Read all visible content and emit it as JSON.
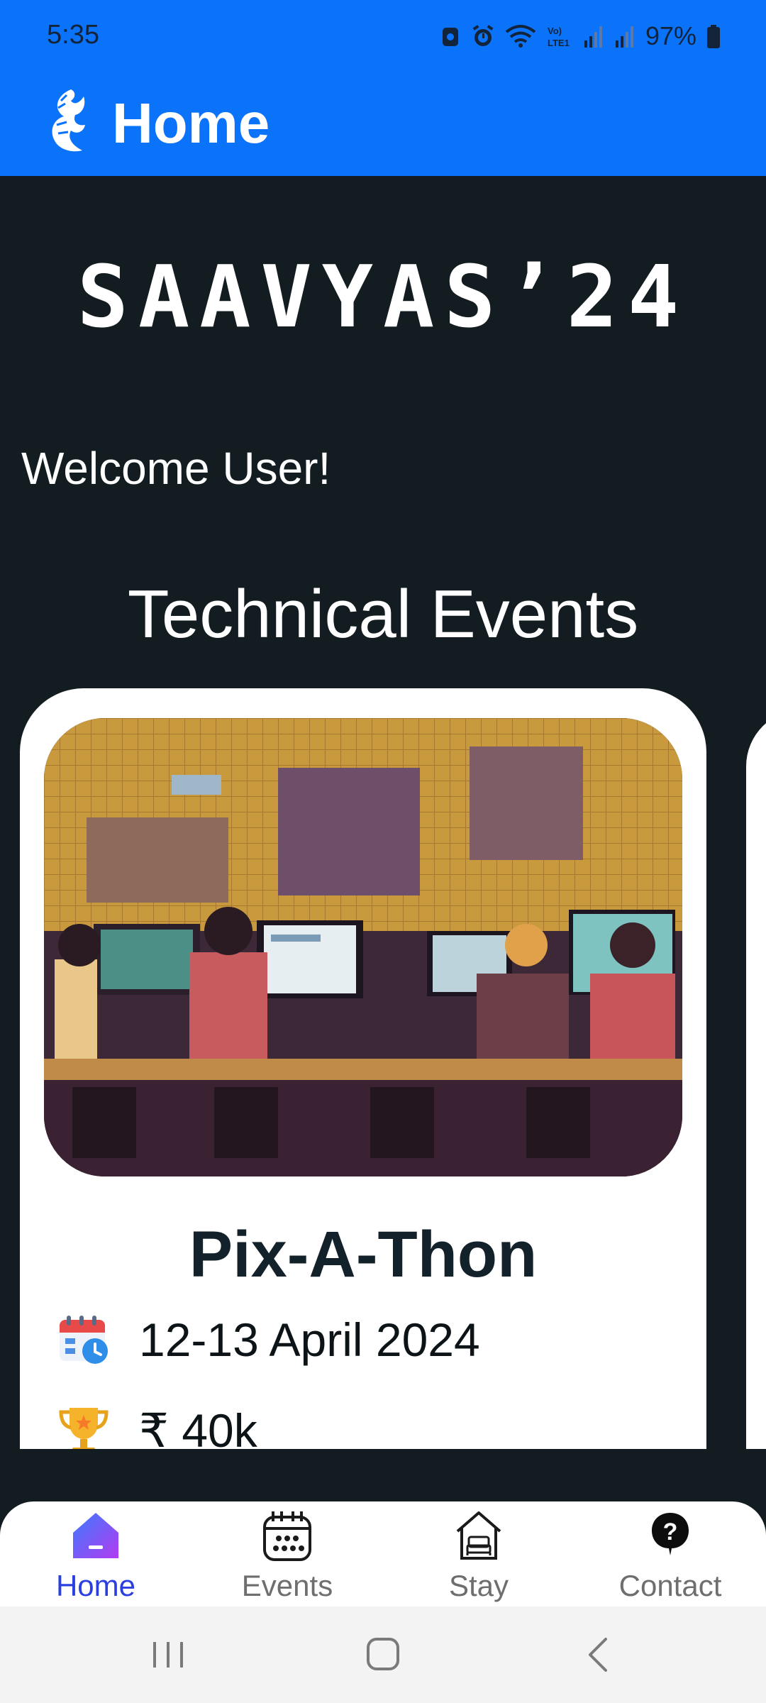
{
  "status_bar": {
    "time": "5:35",
    "battery": "97%"
  },
  "app_bar": {
    "title": "Home"
  },
  "hero": {
    "title": "SAAVYAS’24"
  },
  "welcome": "Welcome User!",
  "section_title": "Technical Events",
  "event_card": {
    "name": "Pix-A-Thon",
    "date": "12-13 April 2024",
    "prize": "₹ 40k"
  },
  "bottom_nav": {
    "items": [
      {
        "label": "Home",
        "icon": "home-icon",
        "active": true
      },
      {
        "label": "Events",
        "icon": "calendar-icon",
        "active": false
      },
      {
        "label": "Stay",
        "icon": "hotel-icon",
        "active": false
      },
      {
        "label": "Contact",
        "icon": "help-icon",
        "active": false
      }
    ]
  },
  "colors": {
    "app_bar": "#0a73fa",
    "background": "#131d21",
    "active_nav": "#2b3fe0",
    "inactive_nav": "#6e6e6e"
  }
}
